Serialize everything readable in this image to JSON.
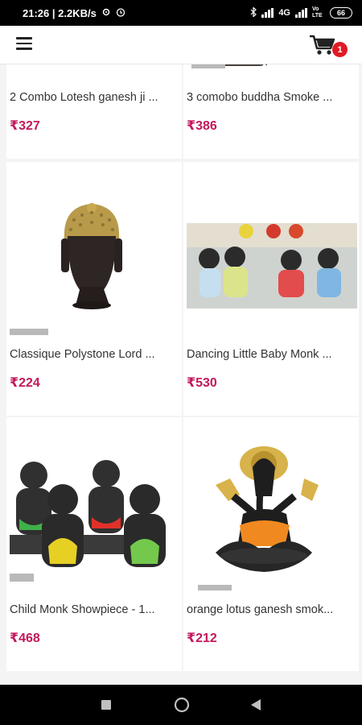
{
  "status_bar": {
    "time_speed": "21:26 | 2.2KB/s",
    "network": "4G",
    "volte": "Vo LTE",
    "battery": "66"
  },
  "app_bar": {
    "menu_icon": "hamburger-menu-icon",
    "cart_icon": "shopping-cart-icon",
    "cart_count": "1"
  },
  "products": [
    {
      "title": "2 Combo Lotesh ganesh ji ...",
      "price": "₹327"
    },
    {
      "title": "3 comobo buddha Smoke ...",
      "price": "₹386"
    },
    {
      "title": "Classique Polystone Lord ...",
      "price": "₹224"
    },
    {
      "title": "Dancing Little Baby Monk ...",
      "price": "₹530"
    },
    {
      "title": "Child Monk Showpiece - 1...",
      "price": "₹468"
    },
    {
      "title": "orange lotus ganesh smok...",
      "price": "₹212"
    }
  ],
  "colors": {
    "price": "#c2185b",
    "badge": "#e01b24",
    "status_bar": "#000000"
  }
}
